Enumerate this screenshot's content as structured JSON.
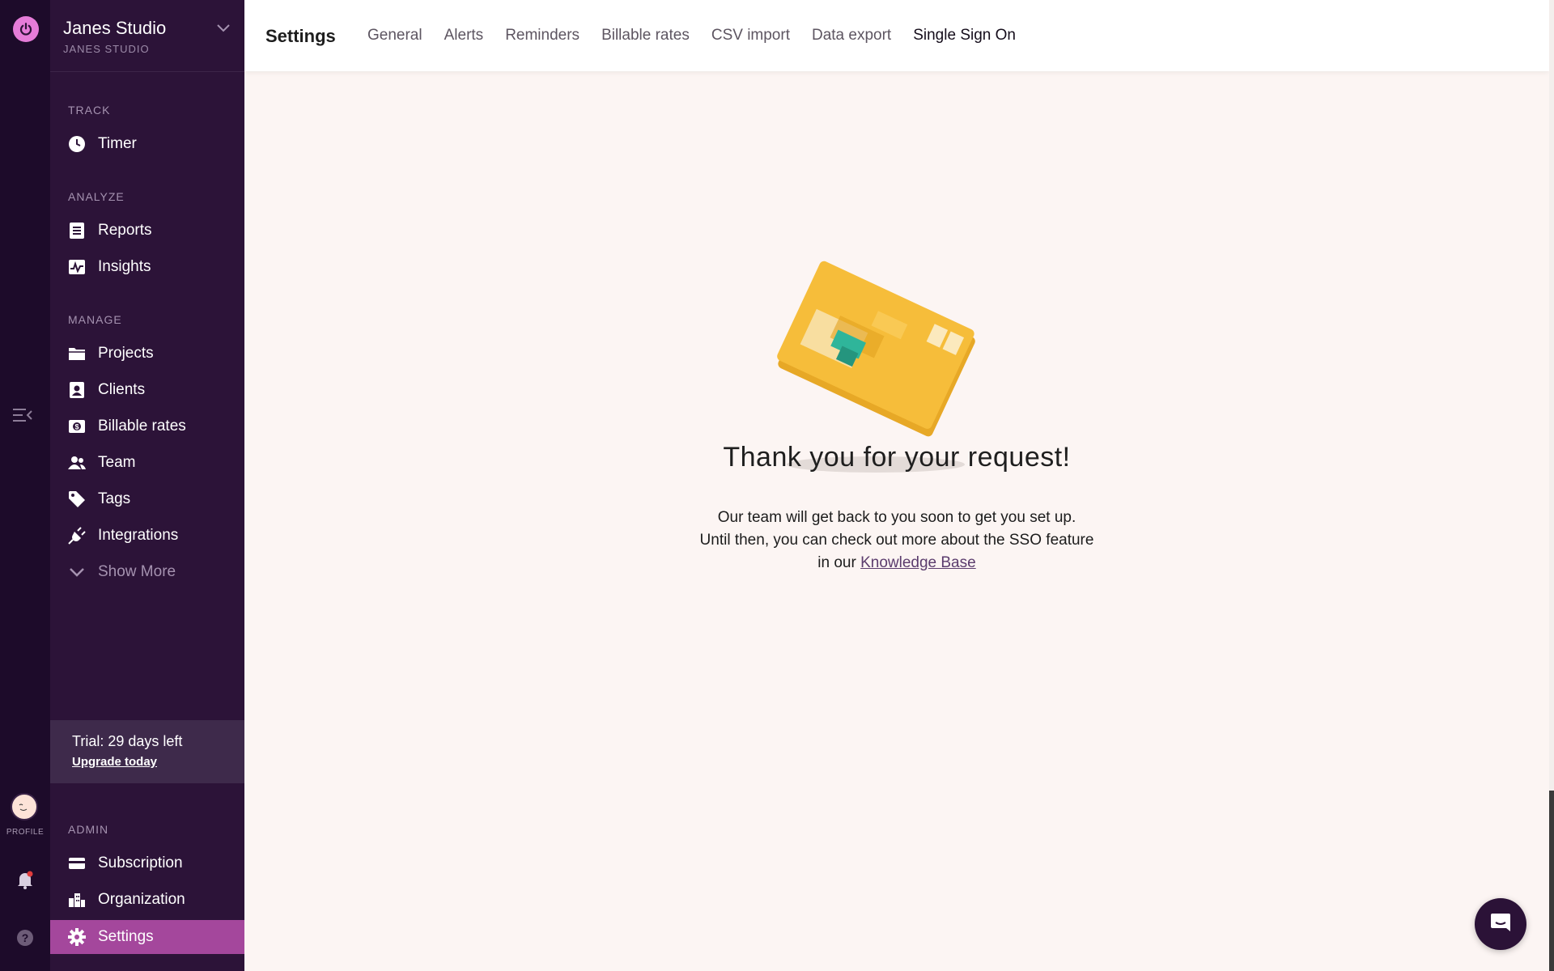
{
  "colors": {
    "rail_bg": "#1d0b2a",
    "sidebar_bg": "#2c1338",
    "accent": "#a4479c",
    "logo": "#e57cd8"
  },
  "rail": {
    "profile_label": "PROFILE"
  },
  "workspace": {
    "name": "Janes Studio",
    "sub": "JANES STUDIO"
  },
  "sections": {
    "track": "TRACK",
    "analyze": "ANALYZE",
    "manage": "MANAGE",
    "admin": "ADMIN"
  },
  "nav": {
    "timer": "Timer",
    "reports": "Reports",
    "insights": "Insights",
    "projects": "Projects",
    "clients": "Clients",
    "billable": "Billable rates",
    "team": "Team",
    "tags": "Tags",
    "integrations": "Integrations",
    "show_more": "Show More",
    "subscription": "Subscription",
    "organization": "Organization",
    "settings": "Settings"
  },
  "trial": {
    "text": "Trial: 29 days left",
    "link": "Upgrade today"
  },
  "header": {
    "title": "Settings",
    "tabs": [
      "General",
      "Alerts",
      "Reminders",
      "Billable rates",
      "CSV import",
      "Data export",
      "Single Sign On"
    ],
    "active_tab": "Single Sign On"
  },
  "content": {
    "heading": "Thank you for your request!",
    "line1": "Our team will get back to you soon to get you set up.",
    "line2": "Until then, you can check out more about the SSO feature",
    "line3_prefix": "in our ",
    "link": "Knowledge Base"
  },
  "icons": [
    "power-icon",
    "menu-collapse-icon",
    "avatar",
    "bell-icon",
    "help-icon",
    "chevron-down-icon",
    "clock-icon",
    "report-icon",
    "insights-icon",
    "folder-icon",
    "client-icon",
    "dollar-icon",
    "team-icon",
    "tag-icon",
    "plug-icon",
    "gear-icon",
    "card-icon",
    "building-icon",
    "chat-icon"
  ]
}
